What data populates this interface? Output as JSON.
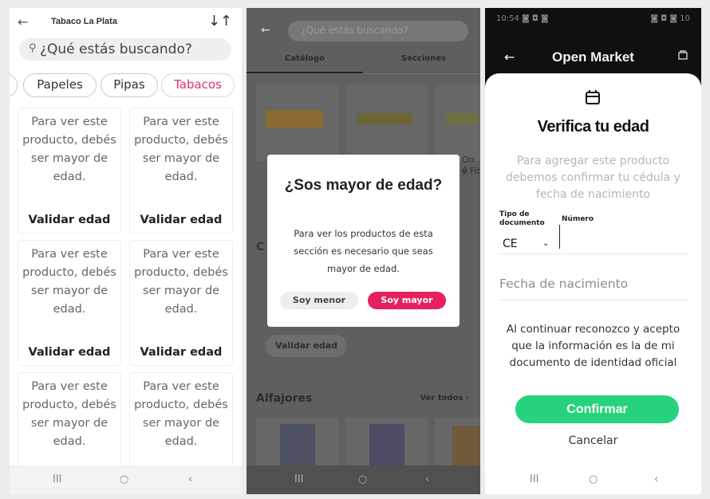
{
  "panel1": {
    "store_title": "Tabaco La Plata",
    "back_icon": "←",
    "sort_icon": "↓↑",
    "search_icon": "⚲",
    "search_placeholder": "¿Qué estás buscando?",
    "chips": [
      {
        "label": "Papeles",
        "active": false
      },
      {
        "label": "Pipas",
        "active": false
      },
      {
        "label": "Tabacos",
        "active": true
      }
    ],
    "card_message": "Para ver este producto, debés ser mayor de edad.",
    "card_action": "Validar edad",
    "nav": {
      "recent": "III",
      "home": "○",
      "back": "‹"
    }
  },
  "panel2": {
    "back_icon": "←",
    "search_placeholder": "¿Qué estás buscando?",
    "tabs": [
      "Catálogo",
      "Secciones"
    ],
    "partial_texts": [
      "On A",
      "y Fit",
      "C"
    ],
    "validar_label": "Validar edad",
    "section_title": "Alfajores",
    "see_all": "Ver todos ›",
    "modal": {
      "title": "¿Sos mayor de edad?",
      "body": "Para ver los productos de esta sección es necesario que seas mayor de edad.",
      "btn_minor": "Soy menor",
      "btn_major": "Soy mayor",
      "accent": "#e7215f"
    },
    "nav": {
      "recent": "III",
      "home": "○",
      "back": "‹"
    }
  },
  "panel3": {
    "status_left": "10:54 ◙ ◘ ◙",
    "status_right": "◙ ◘ ◙ 10",
    "back_icon": "←",
    "title": "Open Market",
    "verify_title": "Verifica tu edad",
    "verify_subtitle": "Para agregar este producto debemos confirmar tu cédula y fecha de nacimiento",
    "doc_type_label": "Tipo de documento",
    "doc_type_value": "CE",
    "doc_type_caret": "⌄",
    "number_label": "Número",
    "birth_placeholder": "Fecha de nacimiento",
    "legal_text": "Al continuar reconozco y acepto que la información es la de mi documento de identidad oficial",
    "confirm_label": "Confirmar",
    "cancel_label": "Cancelar",
    "accent": "#26d37c",
    "nav": {
      "recent": "III",
      "home": "○",
      "back": "‹"
    }
  }
}
